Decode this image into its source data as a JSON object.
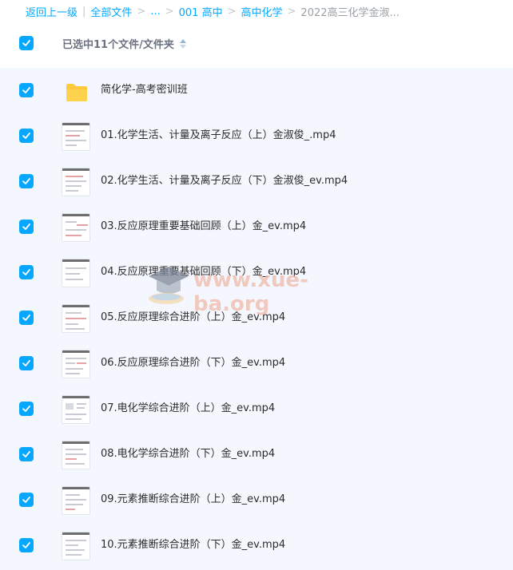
{
  "breadcrumb": {
    "items": [
      {
        "label": "返回上一级",
        "link": true
      },
      {
        "label": "全部文件",
        "link": true
      },
      {
        "label": "...",
        "link": true
      },
      {
        "label": "001 高中",
        "link": true
      },
      {
        "label": "高中化学",
        "link": true
      },
      {
        "label": "2022高三化学金淑...",
        "link": false
      }
    ],
    "divider": "|",
    "separator": ">"
  },
  "header": {
    "selected_text": "已选中11个文件/文件夹"
  },
  "files": [
    {
      "name": "简化学-高考密训班",
      "type": "folder"
    },
    {
      "name": "01.化学生活、计量及离子反应（上）金淑俊_.mp4",
      "type": "video"
    },
    {
      "name": "02.化学生活、计量及离子反应（下）金淑俊_ev.mp4",
      "type": "video"
    },
    {
      "name": "03.反应原理重要基础回顾（上）金_ev.mp4",
      "type": "video"
    },
    {
      "name": "04.反应原理重要基础回顾（下）金_ev.mp4",
      "type": "video"
    },
    {
      "name": "05.反应原理综合进阶（上）金_ev.mp4",
      "type": "video"
    },
    {
      "name": "06.反应原理综合进阶（下）金_ev.mp4",
      "type": "video"
    },
    {
      "name": "07.电化学综合进阶（上）金_ev.mp4",
      "type": "video"
    },
    {
      "name": "08.电化学综合进阶（下）金_ev.mp4",
      "type": "video"
    },
    {
      "name": "09.元素推断综合进阶（上）金_ev.mp4",
      "type": "video"
    },
    {
      "name": "10.元素推断综合进阶（下）金_ev.mp4",
      "type": "video"
    }
  ],
  "watermark": {
    "text": "www.xue-ba.org"
  },
  "colors": {
    "accent": "#06a7ff",
    "list_bg": "#f4f8fe",
    "folder": "#ffd24d"
  }
}
